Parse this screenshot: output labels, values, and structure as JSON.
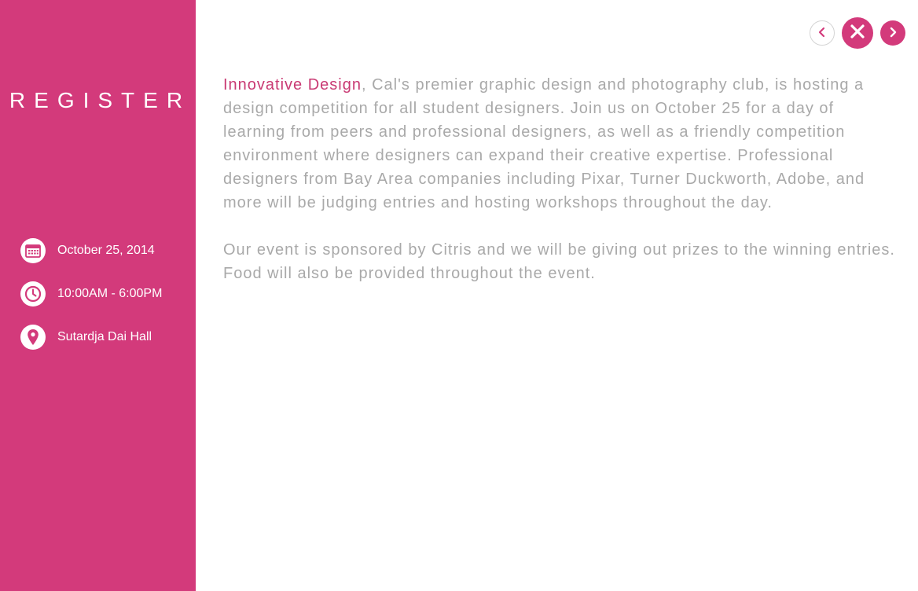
{
  "sidebar": {
    "register_label": "REGISTER",
    "details": [
      {
        "icon": "calendar-icon",
        "text": "October 25, 2014"
      },
      {
        "icon": "clock-icon",
        "text": "10:00AM - 6:00PM"
      },
      {
        "icon": "location-pin-icon",
        "text": "Sutardja Dai Hall"
      }
    ]
  },
  "nav": {
    "prev_icon": "chevron-left-icon",
    "close_icon": "close-icon",
    "next_icon": "chevron-right-icon"
  },
  "content": {
    "club_link": "Innovative Design",
    "paragraph1_rest": ", Cal's premier graphic design and photography club, is hosting a design competition for all student designers. Join us on October 25 for a day of learning from peers and professional designers, as well as a friendly competition environment where designers can expand their creative expertise. Professional designers from Bay Area companies including Pixar, Turner Duckworth, Adobe, and more will be judging entries and hosting workshops throughout the day.",
    "paragraph2": "Our event is sponsored by Citris and we will be giving out prizes to the winning entries. Food will also be provided throughout the event."
  },
  "colors": {
    "accent": "#d33a7b",
    "link": "#c93a73",
    "body_text": "#a9a9a9",
    "border": "#d4d4d4"
  }
}
